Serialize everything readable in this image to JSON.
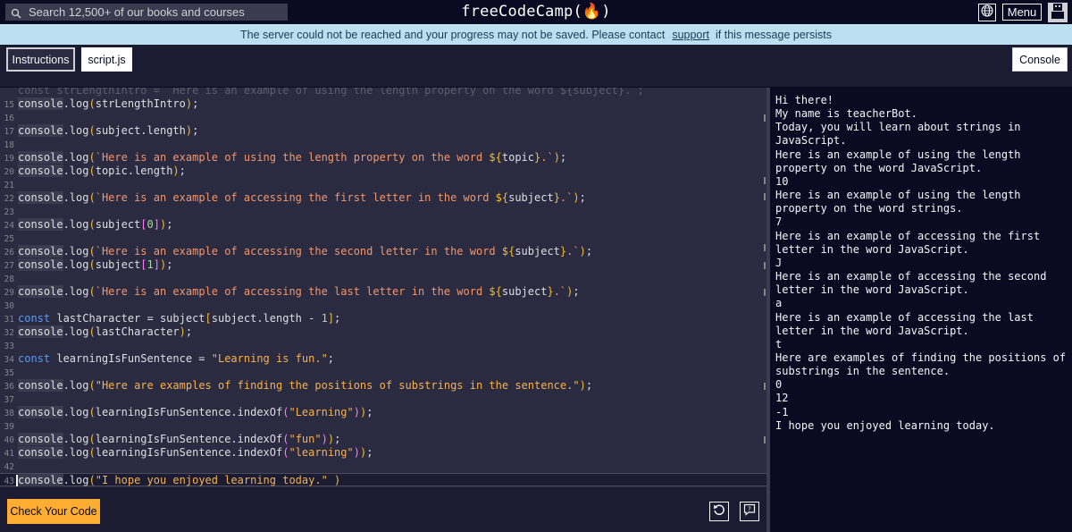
{
  "header": {
    "search_placeholder": "Search 12,500+ of our books and courses",
    "brand": "freeCodeCamp(🔥)",
    "menu_label": "Menu"
  },
  "banner": {
    "text_before": "The server could not be reached and your progress may not be saved. Please contact",
    "link": "support",
    "text_after": "if this message persists"
  },
  "tabs": {
    "instructions": "Instructions",
    "script": "script.js",
    "console": "Console"
  },
  "editor": {
    "partial_top_line": "const strLengthIntro = `Here is an example of using the length property on the word ${subject}.`;",
    "line_numbers": [
      "15",
      "16",
      "17",
      "18",
      "19",
      "20",
      "21",
      "22",
      "23",
      "24",
      "25",
      "26",
      "27",
      "28",
      "29",
      "30",
      "31",
      "32",
      "33",
      "34",
      "35",
      "36",
      "37",
      "38",
      "39",
      "40",
      "41",
      "42",
      "43"
    ]
  },
  "actions": {
    "check_code": "Check Your Code"
  },
  "console_output": [
    "Hi there!",
    "My name is teacherBot.",
    "Today, you will learn about strings in JavaScript.",
    "Here is an example of using the length property on the word JavaScript.",
    "10",
    "Here is an example of using the length property on the word strings.",
    "7",
    "Here is an example of accessing the first letter in the word JavaScript.",
    "J",
    "Here is an example of accessing the second letter in the word JavaScript.",
    "a",
    "Here is an example of accessing the last letter in the word JavaScript.",
    "t",
    "Here are examples of finding the positions of substrings in the sentence.",
    "0",
    "12",
    "-1",
    "I hope you enjoyed learning today."
  ],
  "colors": {
    "background": "#0a0a23",
    "panel": "#1b1b32",
    "editor": "#2a2a40",
    "accent_button": "#feac32",
    "banner": "#bde0f0",
    "keyword": "#5a9bf0",
    "string": "#f7b24f"
  }
}
